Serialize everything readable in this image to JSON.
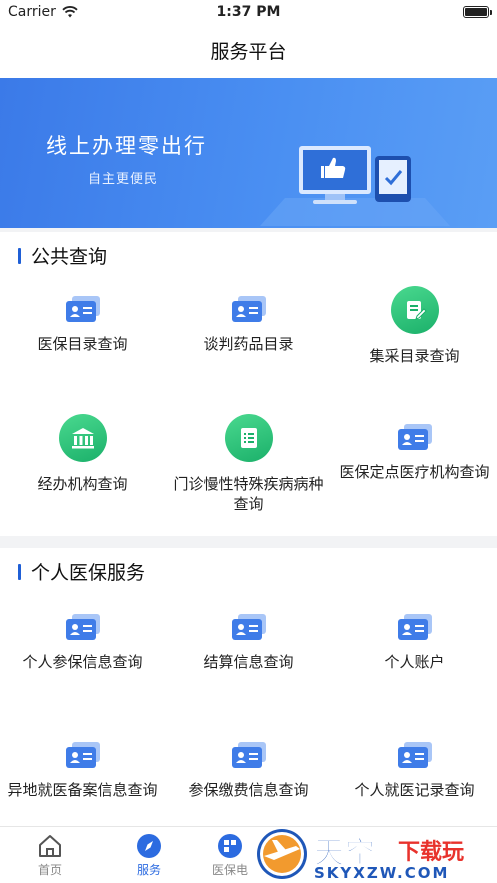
{
  "status": {
    "carrier": "Carrier",
    "time": "1:37 PM"
  },
  "nav": {
    "title": "服务平台"
  },
  "banner": {
    "title": "线上办理零出行",
    "subtitle": "自主更便民"
  },
  "public_query": {
    "title": "公共查询",
    "items": [
      {
        "label": "医保目录查询",
        "icon": "id-card-icon"
      },
      {
        "label": "谈判药品目录",
        "icon": "id-card-icon"
      },
      {
        "label": "集采目录查询",
        "icon": "document-icon"
      },
      {
        "label": "经办机构查询",
        "icon": "institution-icon"
      },
      {
        "label": "门诊慢性特殊疾病病种查询",
        "icon": "list-icon"
      },
      {
        "label": "医保定点医疗机构查询",
        "icon": "id-card-icon"
      }
    ]
  },
  "personal_service": {
    "title": "个人医保服务",
    "items": [
      {
        "label": "个人参保信息查询",
        "icon": "id-card-icon"
      },
      {
        "label": "结算信息查询",
        "icon": "id-card-icon"
      },
      {
        "label": "个人账户",
        "icon": "id-card-icon"
      },
      {
        "label": "异地就医备案信息查询",
        "icon": "id-card-icon"
      },
      {
        "label": "参保缴费信息查询",
        "icon": "id-card-icon"
      },
      {
        "label": "个人就医记录查询",
        "icon": "id-card-icon"
      }
    ]
  },
  "tabs": [
    {
      "label": "首页",
      "icon": "home-icon",
      "active": false
    },
    {
      "label": "服务",
      "icon": "compass-icon",
      "active": true
    },
    {
      "label": "医保电",
      "icon": "qr-icon",
      "active": false
    }
  ],
  "watermark": {
    "brand": "天空",
    "brand_sub": "下载玩",
    "site": "SKYXZW.COM"
  },
  "colors": {
    "accent": "#2c6be0",
    "banner": "#4a8ff2",
    "green": "#1bb06a"
  }
}
